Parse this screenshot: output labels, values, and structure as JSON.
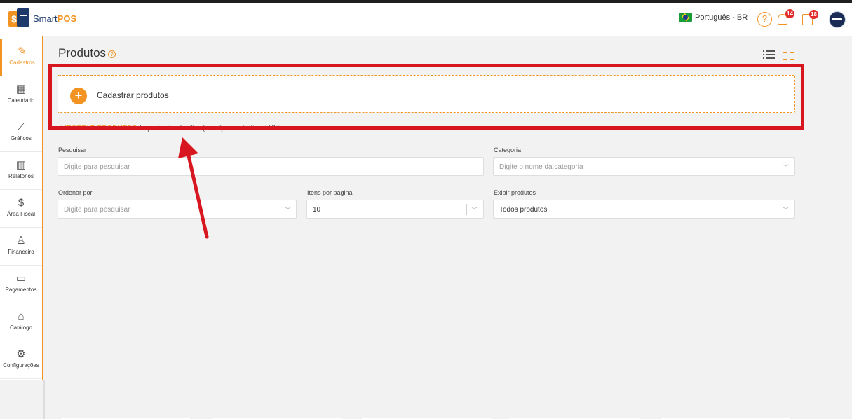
{
  "app": {
    "logo_badge": "$",
    "logo_name": "Smart",
    "logo_suffix": "POS"
  },
  "header": {
    "language": "Português - BR",
    "help_icon": "question-circle-icon",
    "help_glyph": "?",
    "notifications_count": "14",
    "calendar_count": "18"
  },
  "sidebar": {
    "items": [
      {
        "label": "Cadastros",
        "icon": "✎"
      },
      {
        "label": "Calendário",
        "icon": "▦"
      },
      {
        "label": "Gráficos",
        "icon": "⟋"
      },
      {
        "label": "Relatórios",
        "icon": "▥"
      },
      {
        "label": "Área Fiscal",
        "icon": "$"
      },
      {
        "label": "Financeiro",
        "icon": "♙"
      },
      {
        "label": "Pagamentos",
        "icon": "▭"
      },
      {
        "label": "Catálogo",
        "icon": "⌂"
      },
      {
        "label": "Configurações",
        "icon": "⚙"
      }
    ]
  },
  "main": {
    "title": "Produtos",
    "title_help": "?",
    "add_button_glyph": "+",
    "add_label": "Cadastrar produtos",
    "import_link": "IMPORTAR PRODUTOS",
    "import_text": "Importe via planilha (excel) ou nota fiscal XML."
  },
  "filters": {
    "search_label": "Pesquisar",
    "search_placeholder": "Digite para pesquisar",
    "category_label": "Categoria",
    "category_placeholder": "Digite o nome da categoria",
    "order_label": "Ordenar por",
    "order_placeholder": "Digite para pesquisar",
    "items_label": "Itens por página",
    "items_value": "10",
    "show_label": "Exibir produtos",
    "show_value": "Todos produtos",
    "chevron": "﹀"
  },
  "colors": {
    "accent": "#f29322",
    "brand_navy": "#1e3a6b",
    "highlight_red": "#d8161f",
    "badge_red": "#e22b2b"
  }
}
